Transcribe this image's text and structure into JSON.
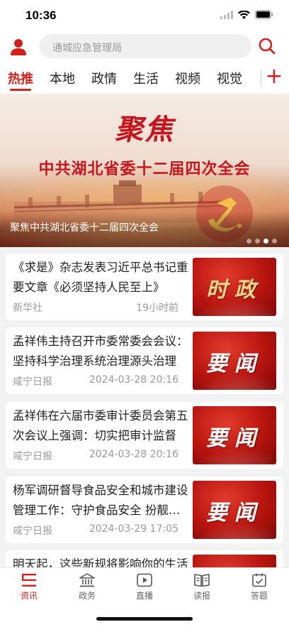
{
  "status_bar": {
    "time": "10:36"
  },
  "search": {
    "placeholder": "通城应急管理局"
  },
  "tabs": [
    {
      "label": "热推",
      "active": true
    },
    {
      "label": "本地"
    },
    {
      "label": "政情"
    },
    {
      "label": "生活"
    },
    {
      "label": "视频"
    },
    {
      "label": "视觉"
    }
  ],
  "banner": {
    "kicker": "聚焦",
    "headline": "中共湖北省委十二届四次全会",
    "caption": "聚焦中共湖北省委十二届四次全会",
    "slide_count": 4,
    "active_slide": 3
  },
  "news": [
    {
      "title": "《求是》杂志发表习近平总书记重要文章《必须坚持人民至上》",
      "source": "新华社",
      "time": "19小时前",
      "thumb_text": "时政"
    },
    {
      "title": "孟祥伟主持召开市委常委会会议：坚持科学治理系统治理源头治理",
      "source": "咸宁日报",
      "time": "2024-03-28 20:16",
      "thumb_text": "要闻"
    },
    {
      "title": "孟祥伟在六届市委审计委员会第五次会议上强调：切实把审计监督",
      "source": "咸宁日报",
      "time": "2024-03-28 20:16",
      "thumb_text": "要闻"
    },
    {
      "title": "杨军调研督导食品安全和城市建设管理工作：守护食品安全 扮靓城市",
      "source": "咸宁日报",
      "time": "2024-03-29 17:05",
      "thumb_text": "要闻"
    },
    {
      "title": "明天起，这些新规将影响你的生活",
      "source": "",
      "time": "",
      "thumb_text": ""
    }
  ],
  "bottom_nav": [
    {
      "label": "资讯",
      "icon": "news-icon",
      "active": true
    },
    {
      "label": "政务",
      "icon": "government-icon"
    },
    {
      "label": "直播",
      "icon": "play-icon"
    },
    {
      "label": "读报",
      "icon": "newspaper-icon"
    },
    {
      "label": "答题",
      "icon": "quiz-icon"
    }
  ],
  "colors": {
    "accent": "#d0211c",
    "background": "#f2f2f2"
  }
}
